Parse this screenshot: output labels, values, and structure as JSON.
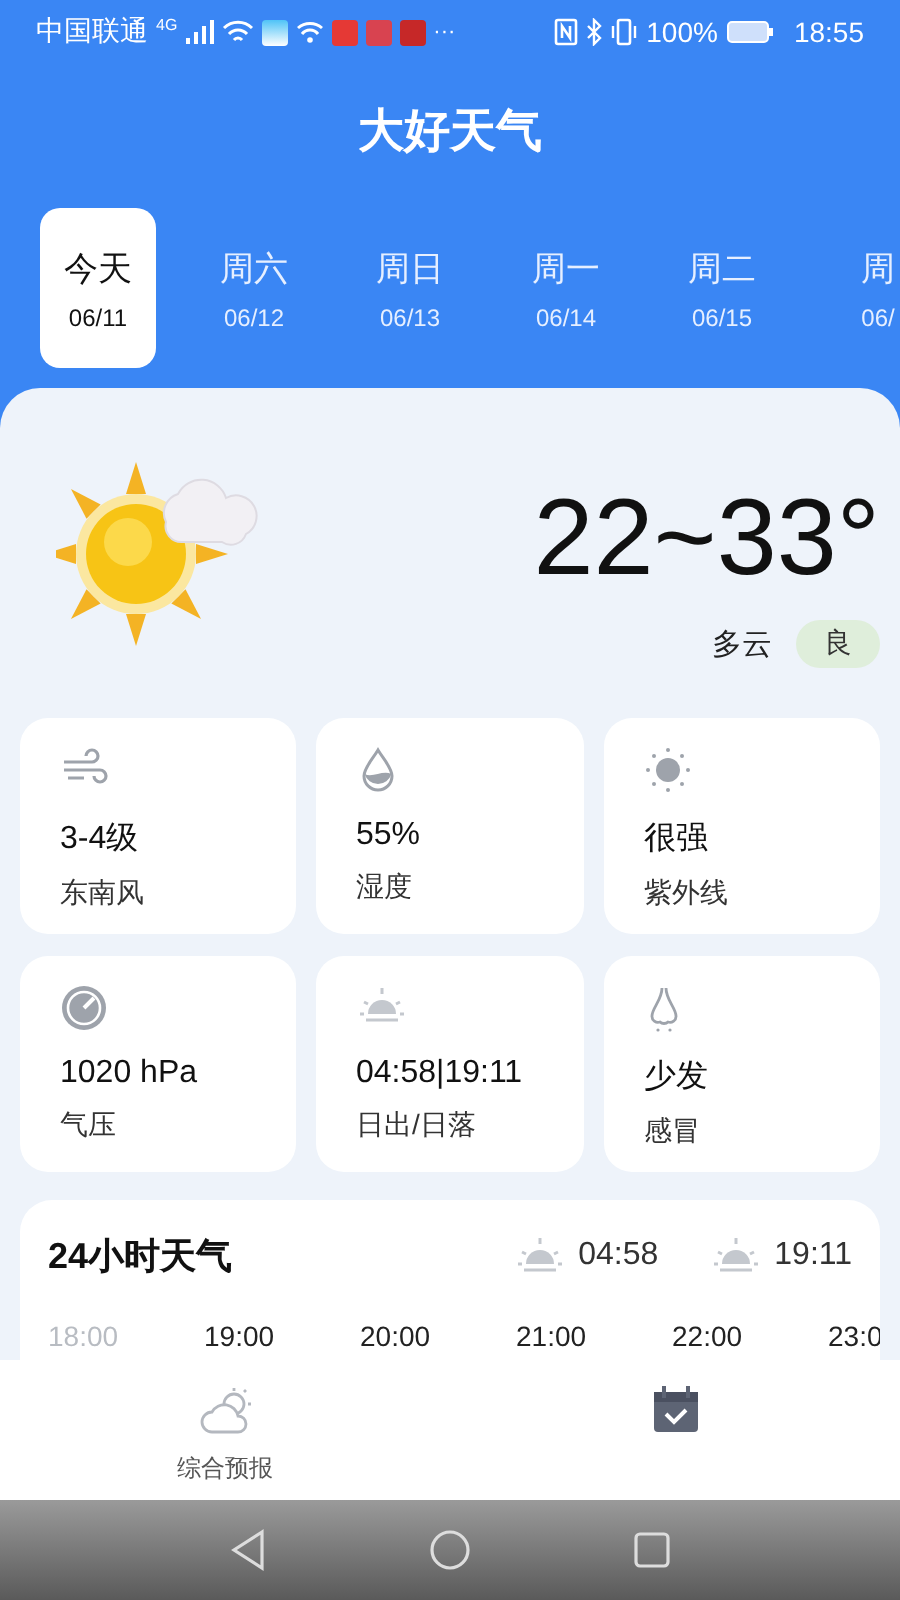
{
  "status_bar": {
    "carrier": "中国联通",
    "network": "4G",
    "more": "···",
    "battery": "100%",
    "time": "18:55"
  },
  "app_title": "大好天气",
  "days": [
    {
      "label": "今天",
      "date": "06/11",
      "selected": true
    },
    {
      "label": "周六",
      "date": "06/12",
      "selected": false
    },
    {
      "label": "周日",
      "date": "06/13",
      "selected": false
    },
    {
      "label": "周一",
      "date": "06/14",
      "selected": false
    },
    {
      "label": "周二",
      "date": "06/15",
      "selected": false
    },
    {
      "label": "周",
      "date": "06/",
      "selected": false
    }
  ],
  "today": {
    "temperature": "22~33°",
    "condition": "多云",
    "air_quality": "良"
  },
  "details": [
    {
      "kind": "wind",
      "value": "3-4级",
      "label": "东南风"
    },
    {
      "kind": "humidity",
      "value": "55%",
      "label": "湿度"
    },
    {
      "kind": "uv",
      "value": "很强",
      "label": "紫外线"
    },
    {
      "kind": "pressure",
      "value": "1020 hPa",
      "label": "气压"
    },
    {
      "kind": "sun",
      "value": "04:58|19:11",
      "label": "日出/日落"
    },
    {
      "kind": "cold",
      "value": "少发",
      "label": "感冒"
    }
  ],
  "hourly": {
    "title": "24小时天气",
    "sunrise": "04:58",
    "sunset": "19:11",
    "hours": [
      {
        "time": "18:00",
        "past": true
      },
      {
        "time": "19:00",
        "past": false
      },
      {
        "time": "20:00",
        "past": false
      },
      {
        "time": "21:00",
        "past": false
      },
      {
        "time": "22:00",
        "past": false
      },
      {
        "time": "23:0",
        "past": false
      }
    ]
  },
  "bottom_nav": [
    {
      "kind": "forecast",
      "label": "综合预报",
      "selected": false
    },
    {
      "kind": "calendar",
      "selected": true
    }
  ]
}
